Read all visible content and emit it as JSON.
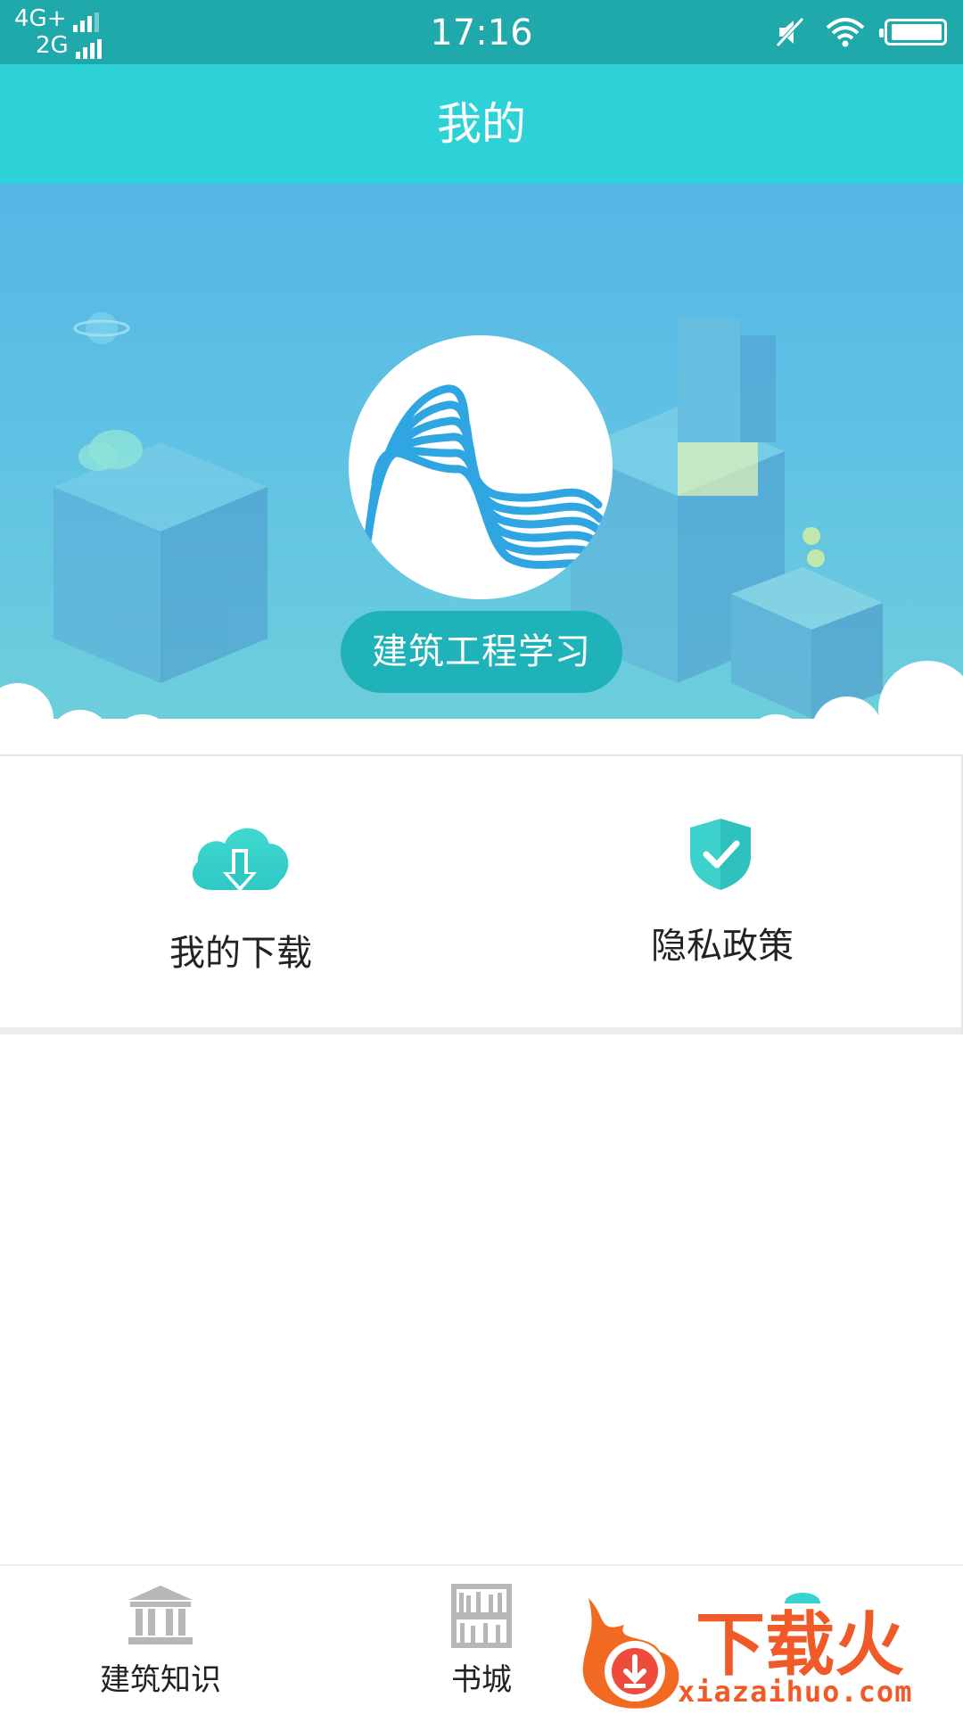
{
  "status_bar": {
    "network_primary": "4G+",
    "network_secondary": "2G",
    "time": "17:16"
  },
  "header": {
    "title": "我的"
  },
  "profile": {
    "name": "建筑工程学习"
  },
  "menu": {
    "items": [
      {
        "label": "我的下载",
        "icon": "cloud-download-icon"
      },
      {
        "label": "隐私政策",
        "icon": "shield-check-icon"
      }
    ]
  },
  "bottom_nav": {
    "items": [
      {
        "label": "建筑知识",
        "icon": "building-icon"
      },
      {
        "label": "书城",
        "icon": "bookshelf-icon"
      }
    ]
  },
  "watermark": {
    "brand": "下载火",
    "url": "xiazaihuo.com"
  },
  "colors": {
    "status_bar": "#20a9ab",
    "title_bar": "#2cd2d7",
    "name_pill": "#1fb2b8",
    "accent": "#37d4cf",
    "watermark": "#f05a28"
  }
}
